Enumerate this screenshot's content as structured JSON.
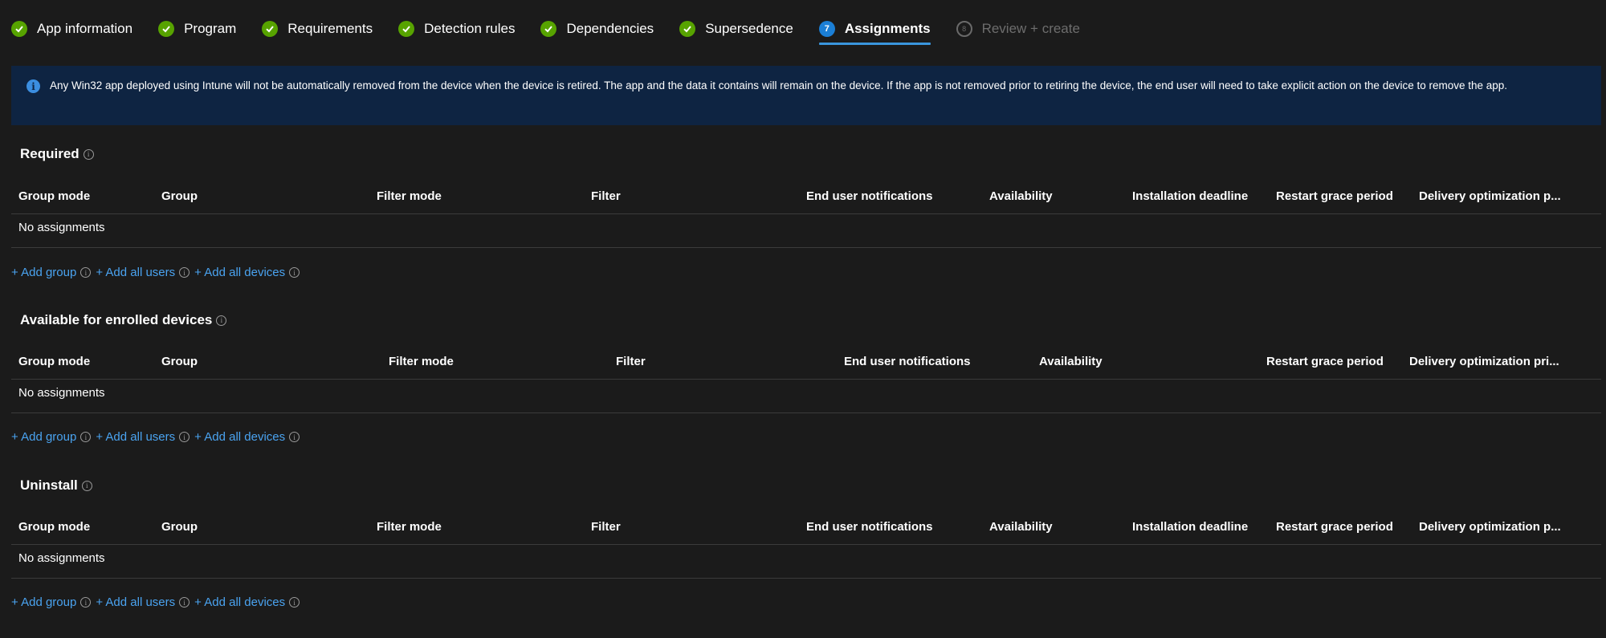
{
  "wizard": {
    "steps": [
      {
        "label": "App information",
        "status": "done"
      },
      {
        "label": "Program",
        "status": "done"
      },
      {
        "label": "Requirements",
        "status": "done"
      },
      {
        "label": "Detection rules",
        "status": "done"
      },
      {
        "label": "Dependencies",
        "status": "done"
      },
      {
        "label": "Supersedence",
        "status": "done"
      },
      {
        "label": "Assignments",
        "status": "current",
        "number": "7"
      },
      {
        "label": "Review + create",
        "status": "pending",
        "number": "8"
      }
    ]
  },
  "banner": {
    "text": "Any Win32 app deployed using Intune will not be automatically removed from the device when the device is retired. The app and the data it contains will remain on the device. If the app is not removed prior to retiring the device, the end user will need to take explicit action on the device to remove the app."
  },
  "sections": {
    "required": {
      "title": "Required",
      "columns": [
        "Group mode",
        "Group",
        "Filter mode",
        "Filter",
        "End user notifications",
        "Availability",
        "Installation deadline",
        "Restart grace period",
        "Delivery optimization p..."
      ],
      "empty_text": "No assignments",
      "actions": [
        "+ Add group",
        "+ Add all users",
        "+ Add all devices"
      ]
    },
    "available": {
      "title": "Available for enrolled devices",
      "columns": [
        "Group mode",
        "Group",
        "Filter mode",
        "Filter",
        "End user notifications",
        "Availability",
        "Restart grace period",
        "Delivery optimization pri..."
      ],
      "empty_text": "No assignments",
      "actions": [
        "+ Add group",
        "+ Add all users",
        "+ Add all devices"
      ]
    },
    "uninstall": {
      "title": "Uninstall",
      "columns": [
        "Group mode",
        "Group",
        "Filter mode",
        "Filter",
        "End user notifications",
        "Availability",
        "Installation deadline",
        "Restart grace period",
        "Delivery optimization p..."
      ],
      "empty_text": "No assignments",
      "actions": [
        "+ Add group",
        "+ Add all users",
        "+ Add all devices"
      ]
    }
  },
  "colors": {
    "background": "#1b1b1b",
    "banner": "#0e2442",
    "success": "#57a300",
    "accent": "#1b7fd6",
    "link": "#4aa3f0"
  }
}
